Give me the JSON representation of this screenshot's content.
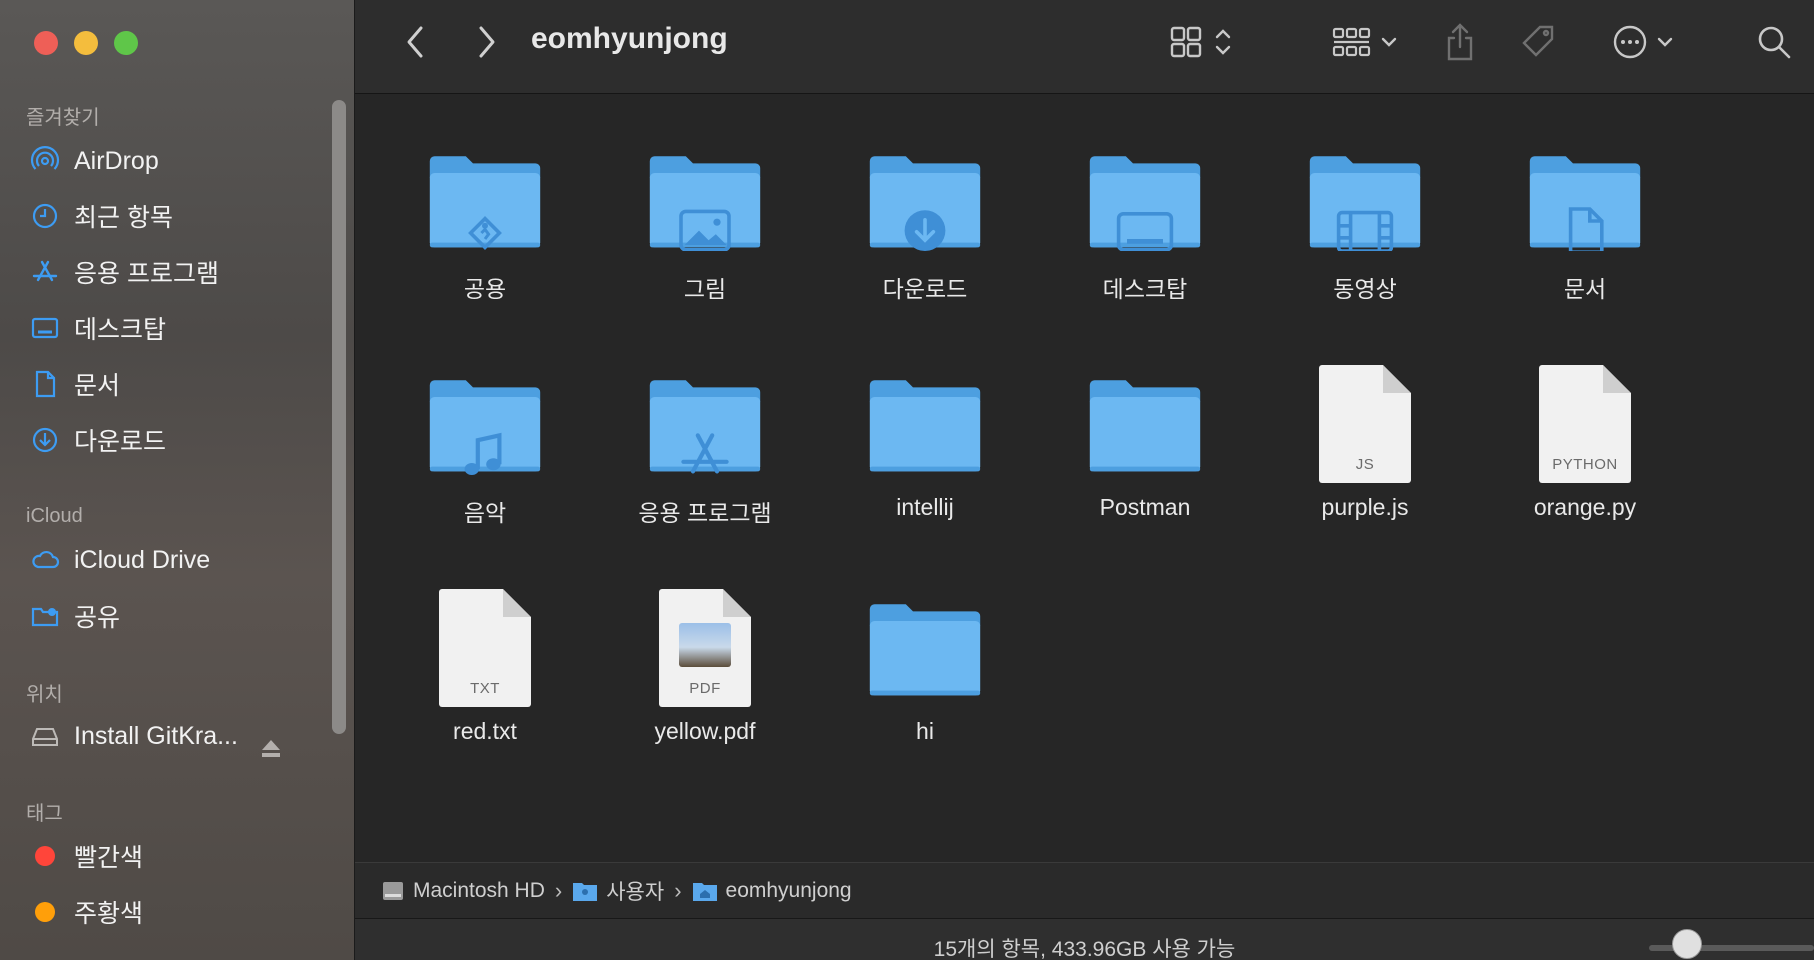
{
  "window": {
    "title": "eomhyunjong"
  },
  "sidebar": {
    "favorites_label": "즐겨찾기",
    "favorites": [
      {
        "label": "AirDrop",
        "icon": "airdrop-icon"
      },
      {
        "label": "최근 항목",
        "icon": "clock-icon"
      },
      {
        "label": "응용 프로그램",
        "icon": "apps-icon"
      },
      {
        "label": "데스크탑",
        "icon": "desktop-icon"
      },
      {
        "label": "문서",
        "icon": "document-icon"
      },
      {
        "label": "다운로드",
        "icon": "download-icon"
      }
    ],
    "icloud_label": "iCloud",
    "icloud": [
      {
        "label": "iCloud Drive",
        "icon": "cloud-icon"
      },
      {
        "label": "공유",
        "icon": "shared-folder-icon"
      }
    ],
    "locations_label": "위치",
    "locations": [
      {
        "label": "Install GitKra...",
        "icon": "disk-icon"
      }
    ],
    "tags_label": "태그",
    "tags": [
      {
        "label": "빨간색",
        "color": "#ff453a"
      },
      {
        "label": "주황색",
        "color": "#ff9f0a"
      }
    ]
  },
  "items": [
    {
      "label": "공용",
      "kind": "folder",
      "glyph": "public"
    },
    {
      "label": "그림",
      "kind": "folder",
      "glyph": "pictures"
    },
    {
      "label": "다운로드",
      "kind": "folder",
      "glyph": "downloads"
    },
    {
      "label": "데스크탑",
      "kind": "folder",
      "glyph": "desktop"
    },
    {
      "label": "동영상",
      "kind": "folder",
      "glyph": "movies"
    },
    {
      "label": "문서",
      "kind": "folder",
      "glyph": "documents"
    },
    {
      "label": "음악",
      "kind": "folder",
      "glyph": "music"
    },
    {
      "label": "응용 프로그램",
      "kind": "folder",
      "glyph": "apps"
    },
    {
      "label": "intellij",
      "kind": "folder",
      "glyph": "none"
    },
    {
      "label": "Postman",
      "kind": "folder",
      "glyph": "none"
    },
    {
      "label": "purple.js",
      "kind": "file",
      "ext": "JS"
    },
    {
      "label": "orange.py",
      "kind": "file",
      "ext": "PYTHON"
    },
    {
      "label": "red.txt",
      "kind": "file",
      "ext": "TXT"
    },
    {
      "label": "yellow.pdf",
      "kind": "file",
      "ext": "PDF",
      "thumb": true
    },
    {
      "label": "hi",
      "kind": "folder",
      "glyph": "none"
    }
  ],
  "pathbar": [
    {
      "label": "Macintosh HD",
      "icon": "hard-drive-icon"
    },
    {
      "label": "사용자",
      "icon": "users-folder-icon"
    },
    {
      "label": "eomhyunjong",
      "icon": "home-folder-icon"
    }
  ],
  "status": {
    "text": "15개의 항목, 433.96GB 사용 가능"
  },
  "colors": {
    "folder": "#6cb8f2",
    "folder_dark": "#4d9fe0",
    "accent": "#2f8cf0"
  }
}
